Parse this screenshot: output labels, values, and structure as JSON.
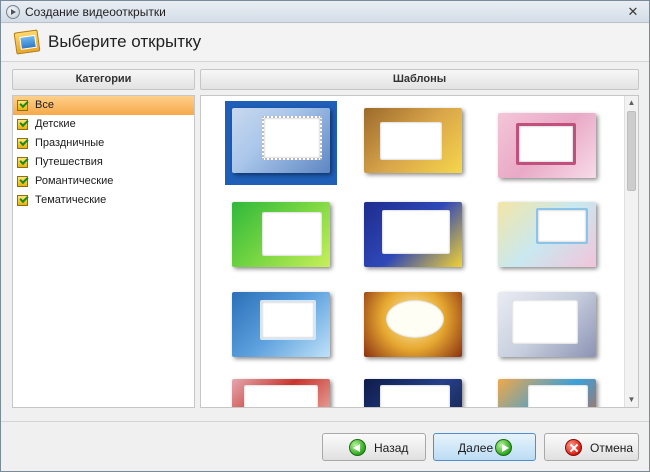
{
  "window": {
    "title": "Создание видеооткрытки",
    "close_glyph": "✕"
  },
  "header": {
    "title": "Выберите открытку"
  },
  "categories": {
    "header": "Категории",
    "items": [
      {
        "label": "Все",
        "selected": true
      },
      {
        "label": "Детские"
      },
      {
        "label": "Праздничные"
      },
      {
        "label": "Путешествия"
      },
      {
        "label": "Романтические"
      },
      {
        "label": "Тематические"
      }
    ]
  },
  "templates": {
    "header": "Шаблоны",
    "selected_index": 0,
    "count_visible": 12
  },
  "scrollbar": {
    "up_glyph": "▲",
    "down_glyph": "▼"
  },
  "buttons": {
    "back": "Назад",
    "next": "Далее",
    "cancel": "Отмена"
  },
  "colors": {
    "selection_blue": "#1f5fb8",
    "category_selected": "#f6a94a",
    "next_button_border": "#4f8fcf"
  }
}
